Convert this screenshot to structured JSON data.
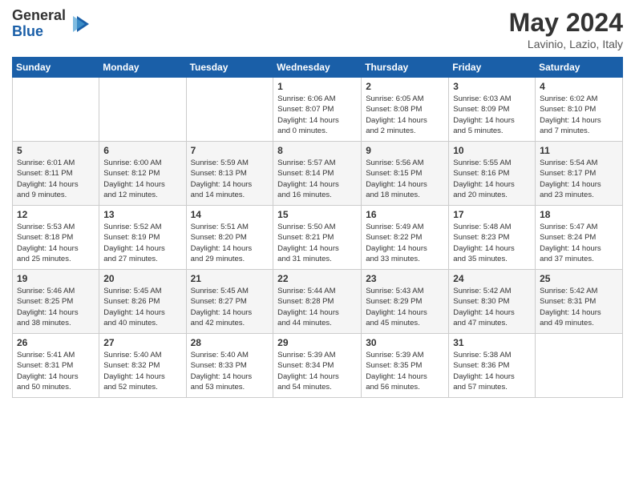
{
  "header": {
    "logo_general": "General",
    "logo_blue": "Blue",
    "month_title": "May 2024",
    "location": "Lavinio, Lazio, Italy"
  },
  "days_of_week": [
    "Sunday",
    "Monday",
    "Tuesday",
    "Wednesday",
    "Thursday",
    "Friday",
    "Saturday"
  ],
  "weeks": [
    [
      {
        "day": "",
        "info": ""
      },
      {
        "day": "",
        "info": ""
      },
      {
        "day": "",
        "info": ""
      },
      {
        "day": "1",
        "info": "Sunrise: 6:06 AM\nSunset: 8:07 PM\nDaylight: 14 hours\nand 0 minutes."
      },
      {
        "day": "2",
        "info": "Sunrise: 6:05 AM\nSunset: 8:08 PM\nDaylight: 14 hours\nand 2 minutes."
      },
      {
        "day": "3",
        "info": "Sunrise: 6:03 AM\nSunset: 8:09 PM\nDaylight: 14 hours\nand 5 minutes."
      },
      {
        "day": "4",
        "info": "Sunrise: 6:02 AM\nSunset: 8:10 PM\nDaylight: 14 hours\nand 7 minutes."
      }
    ],
    [
      {
        "day": "5",
        "info": "Sunrise: 6:01 AM\nSunset: 8:11 PM\nDaylight: 14 hours\nand 9 minutes."
      },
      {
        "day": "6",
        "info": "Sunrise: 6:00 AM\nSunset: 8:12 PM\nDaylight: 14 hours\nand 12 minutes."
      },
      {
        "day": "7",
        "info": "Sunrise: 5:59 AM\nSunset: 8:13 PM\nDaylight: 14 hours\nand 14 minutes."
      },
      {
        "day": "8",
        "info": "Sunrise: 5:57 AM\nSunset: 8:14 PM\nDaylight: 14 hours\nand 16 minutes."
      },
      {
        "day": "9",
        "info": "Sunrise: 5:56 AM\nSunset: 8:15 PM\nDaylight: 14 hours\nand 18 minutes."
      },
      {
        "day": "10",
        "info": "Sunrise: 5:55 AM\nSunset: 8:16 PM\nDaylight: 14 hours\nand 20 minutes."
      },
      {
        "day": "11",
        "info": "Sunrise: 5:54 AM\nSunset: 8:17 PM\nDaylight: 14 hours\nand 23 minutes."
      }
    ],
    [
      {
        "day": "12",
        "info": "Sunrise: 5:53 AM\nSunset: 8:18 PM\nDaylight: 14 hours\nand 25 minutes."
      },
      {
        "day": "13",
        "info": "Sunrise: 5:52 AM\nSunset: 8:19 PM\nDaylight: 14 hours\nand 27 minutes."
      },
      {
        "day": "14",
        "info": "Sunrise: 5:51 AM\nSunset: 8:20 PM\nDaylight: 14 hours\nand 29 minutes."
      },
      {
        "day": "15",
        "info": "Sunrise: 5:50 AM\nSunset: 8:21 PM\nDaylight: 14 hours\nand 31 minutes."
      },
      {
        "day": "16",
        "info": "Sunrise: 5:49 AM\nSunset: 8:22 PM\nDaylight: 14 hours\nand 33 minutes."
      },
      {
        "day": "17",
        "info": "Sunrise: 5:48 AM\nSunset: 8:23 PM\nDaylight: 14 hours\nand 35 minutes."
      },
      {
        "day": "18",
        "info": "Sunrise: 5:47 AM\nSunset: 8:24 PM\nDaylight: 14 hours\nand 37 minutes."
      }
    ],
    [
      {
        "day": "19",
        "info": "Sunrise: 5:46 AM\nSunset: 8:25 PM\nDaylight: 14 hours\nand 38 minutes."
      },
      {
        "day": "20",
        "info": "Sunrise: 5:45 AM\nSunset: 8:26 PM\nDaylight: 14 hours\nand 40 minutes."
      },
      {
        "day": "21",
        "info": "Sunrise: 5:45 AM\nSunset: 8:27 PM\nDaylight: 14 hours\nand 42 minutes."
      },
      {
        "day": "22",
        "info": "Sunrise: 5:44 AM\nSunset: 8:28 PM\nDaylight: 14 hours\nand 44 minutes."
      },
      {
        "day": "23",
        "info": "Sunrise: 5:43 AM\nSunset: 8:29 PM\nDaylight: 14 hours\nand 45 minutes."
      },
      {
        "day": "24",
        "info": "Sunrise: 5:42 AM\nSunset: 8:30 PM\nDaylight: 14 hours\nand 47 minutes."
      },
      {
        "day": "25",
        "info": "Sunrise: 5:42 AM\nSunset: 8:31 PM\nDaylight: 14 hours\nand 49 minutes."
      }
    ],
    [
      {
        "day": "26",
        "info": "Sunrise: 5:41 AM\nSunset: 8:31 PM\nDaylight: 14 hours\nand 50 minutes."
      },
      {
        "day": "27",
        "info": "Sunrise: 5:40 AM\nSunset: 8:32 PM\nDaylight: 14 hours\nand 52 minutes."
      },
      {
        "day": "28",
        "info": "Sunrise: 5:40 AM\nSunset: 8:33 PM\nDaylight: 14 hours\nand 53 minutes."
      },
      {
        "day": "29",
        "info": "Sunrise: 5:39 AM\nSunset: 8:34 PM\nDaylight: 14 hours\nand 54 minutes."
      },
      {
        "day": "30",
        "info": "Sunrise: 5:39 AM\nSunset: 8:35 PM\nDaylight: 14 hours\nand 56 minutes."
      },
      {
        "day": "31",
        "info": "Sunrise: 5:38 AM\nSunset: 8:36 PM\nDaylight: 14 hours\nand 57 minutes."
      },
      {
        "day": "",
        "info": ""
      }
    ]
  ]
}
